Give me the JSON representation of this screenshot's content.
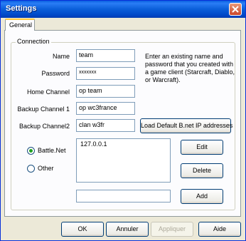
{
  "window": {
    "title": "Settings"
  },
  "tabs": [
    {
      "label": "General"
    }
  ],
  "connection": {
    "legend": "Connection",
    "name_label": "Name",
    "name_value": "team",
    "password_label": "Password",
    "password_value": "xxxxxxx",
    "home_channel_label": "Home Channel",
    "home_channel_value": "op team",
    "backup_channel1_label": "Backup Channel 1",
    "backup_channel1_value": "op wc3france",
    "backup_channel2_label": "Backup Channel2",
    "backup_channel2_value": "clan w3fr",
    "help_text": "Enter an existing name and password that you created with a game client (Starcraft, Diablo, or Warcraft).",
    "load_default_button": "Load Default B.net IP addresses"
  },
  "server": {
    "battlenet_label": "Battle.Net",
    "other_label": "Other",
    "selected": "Battle.Net",
    "list_items": [
      "127.0.0.1"
    ],
    "new_address_value": "",
    "edit_button": "Edit",
    "delete_button": "Delete",
    "add_button": "Add"
  },
  "footer": {
    "ok_button": "OK",
    "cancel_button": "Annuler",
    "apply_button": "Appliquer",
    "help_button": "Aide"
  }
}
